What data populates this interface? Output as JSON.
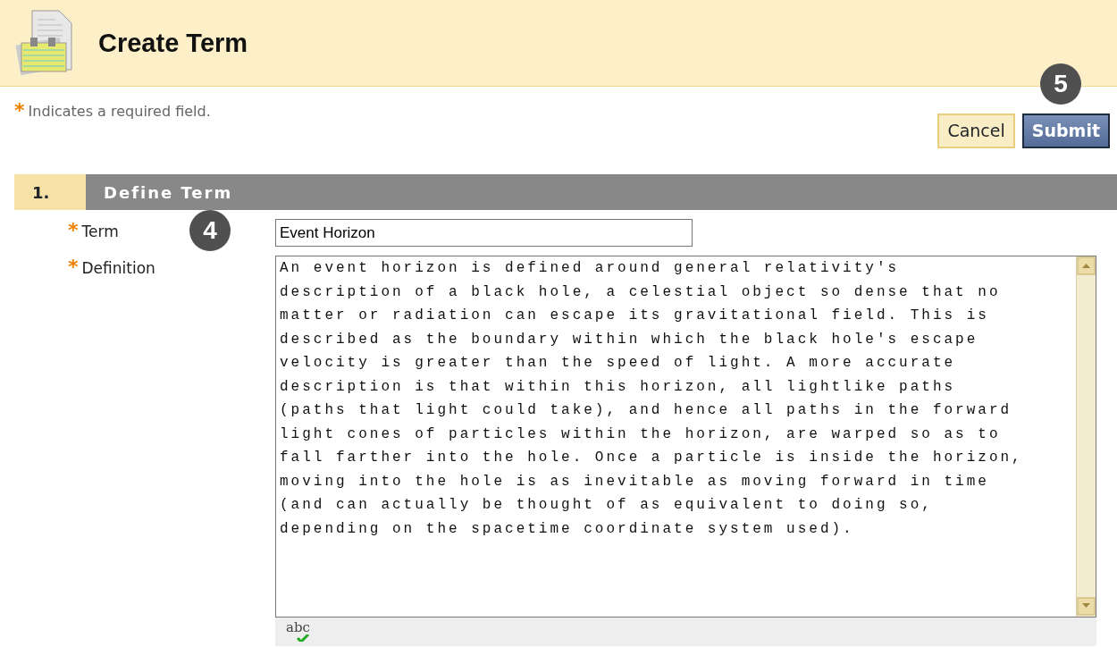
{
  "header": {
    "title": "Create Term"
  },
  "required_note": {
    "marker": "*",
    "text": "Indicates a required field."
  },
  "callouts": [
    {
      "number": "5"
    },
    {
      "number": "4"
    }
  ],
  "buttons": [
    {
      "label": "Cancel",
      "kind": "secondary"
    },
    {
      "label": "Submit",
      "kind": "primary"
    }
  ],
  "section": {
    "number": "1.",
    "title": "Define Term"
  },
  "fields": [
    {
      "label": "Term",
      "required": true,
      "kind": "input",
      "value": "Event Horizon"
    },
    {
      "label": "Definition",
      "required": true,
      "kind": "textarea",
      "value": "An event horizon is defined around general relativity's\ndescription of a black hole, a celestial object so dense that no\nmatter or radiation can escape its gravitational field. This is\ndescribed as the boundary within which the black hole's escape\nvelocity is greater than the speed of light. A more accurate\ndescription is that within this horizon, all lightlike paths\n(paths that light could take), and hence all paths in the forward\nlight cones of particles within the horizon, are warped so as to\nfall farther into the hole. Once a particle is inside the horizon,\nmoving into the hole is as inevitable as moving forward in time\n(and can actually be thought of as equivalent to doing so,\ndepending on the spacetime coordinate system used)."
    }
  ],
  "spellcheck": {
    "label": "abc"
  }
}
